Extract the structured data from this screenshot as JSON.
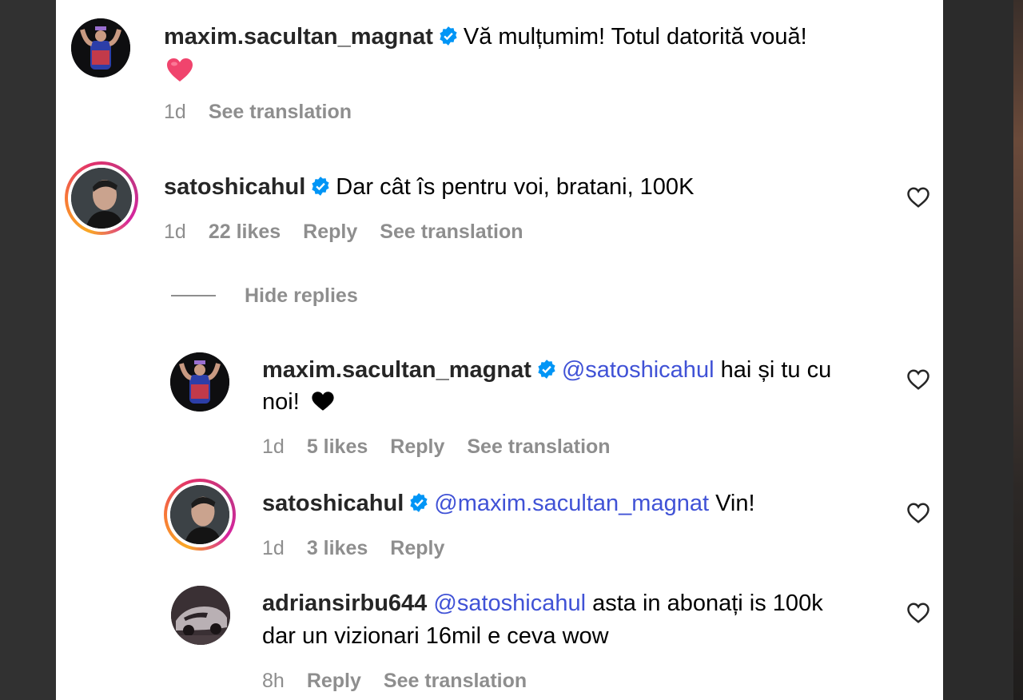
{
  "colors": {
    "mention": "#4052d6",
    "meta": "#8e8e8e",
    "verified": "#0095f6",
    "heart_emoji": "#f0446d"
  },
  "comments": [
    {
      "username": "maxim.sacultan_magnat",
      "verified": true,
      "text": "Vă mulțumim! Totul datorită vouă!",
      "emoji": "heart-emoji",
      "time": "1d",
      "see_translation": "See translation"
    },
    {
      "username": "satoshicahul",
      "verified": true,
      "text": "Dar cât îs pentru voi, bratani, 100K",
      "time": "1d",
      "likes": "22 likes",
      "reply": "Reply",
      "see_translation": "See translation"
    }
  ],
  "hide_replies": "Hide replies",
  "replies": [
    {
      "username": "maxim.sacultan_magnat",
      "verified": true,
      "mention": "@satoshicahul",
      "text_line1": "hai și tu cu",
      "text_line2": "noi!",
      "emoji": "black-heart",
      "time": "1d",
      "likes": "5 likes",
      "reply": "Reply",
      "see_translation": "See translation"
    },
    {
      "username": "satoshicahul",
      "verified": true,
      "mention": "@maxim.sacultan_magnat",
      "text": "Vin!",
      "time": "1d",
      "likes": "3 likes",
      "reply": "Reply"
    },
    {
      "username": "adriansirbu644",
      "verified": false,
      "mention": "@satoshicahul",
      "text_line1": "asta in abonați is 100k",
      "text_line2": "dar un vizionari 16mil e ceva wow",
      "time": "8h",
      "reply": "Reply",
      "see_translation": "See translation"
    }
  ]
}
